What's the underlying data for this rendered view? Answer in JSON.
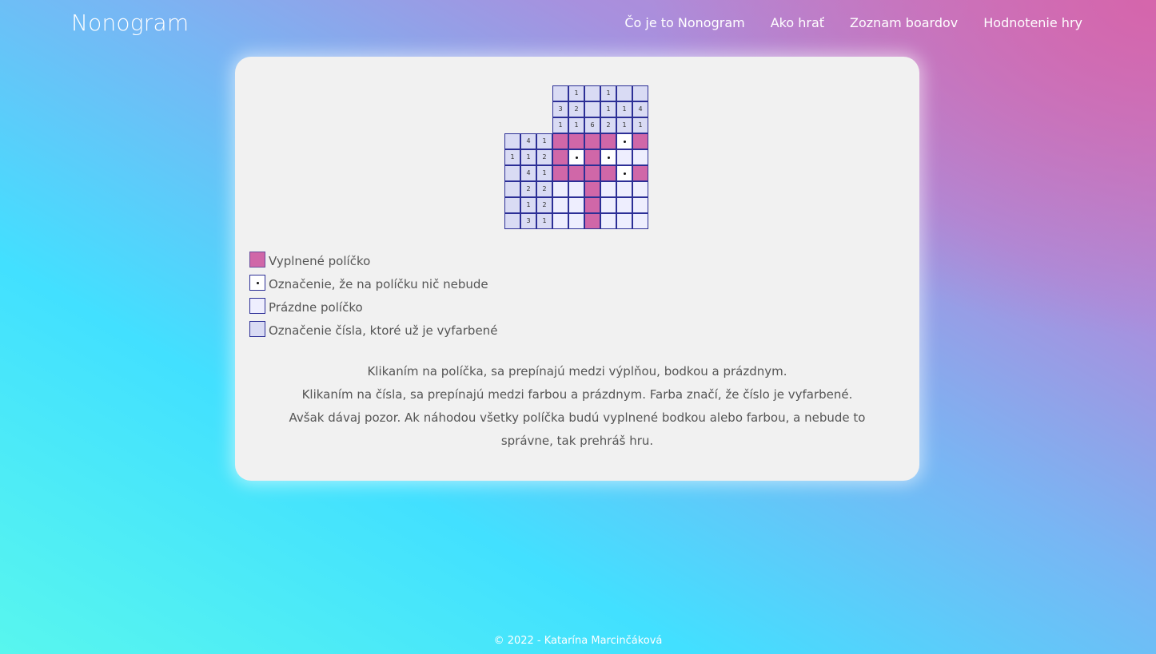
{
  "header": {
    "brand": "Nonogram",
    "nav": [
      "Čo je to Nonogram",
      "Ako hrať",
      "Zoznam boardov",
      "Hodnotenie hry"
    ]
  },
  "board": {
    "column_clues": [
      [
        "",
        "3",
        "1"
      ],
      [
        "1",
        "2",
        "1"
      ],
      [
        "",
        "",
        "6"
      ],
      [
        "1",
        "1",
        "2"
      ],
      [
        "",
        "1",
        "1"
      ],
      [
        "",
        "4",
        "1"
      ]
    ],
    "row_clues": [
      [
        "",
        "4",
        "1"
      ],
      [
        "1",
        "1",
        "2"
      ],
      [
        "",
        "4",
        "1"
      ],
      [
        "",
        "2",
        "2"
      ],
      [
        "",
        "1",
        "2"
      ],
      [
        "",
        "3",
        "1"
      ]
    ],
    "grid": [
      [
        "f",
        "f",
        "f",
        "f",
        "d",
        "f"
      ],
      [
        "f",
        "d",
        "f",
        "d",
        "e",
        "e"
      ],
      [
        "f",
        "f",
        "f",
        "f",
        "d",
        "f"
      ],
      [
        "e",
        "e",
        "f",
        "e",
        "e",
        "e"
      ],
      [
        "e",
        "e",
        "f",
        "e",
        "e",
        "e"
      ],
      [
        "e",
        "e",
        "f",
        "e",
        "e",
        "e"
      ]
    ]
  },
  "legend": [
    {
      "type": "filled",
      "label": "Vyplnené políčko"
    },
    {
      "type": "dotted",
      "label": "Označenie, že na políčku nič nebude"
    },
    {
      "type": "empty",
      "label": "Prázdne políčko"
    },
    {
      "type": "clue",
      "label": "Označenie čísla, ktoré už je vyfarbené"
    }
  ],
  "description": [
    "Klikaním na políčka, sa prepínajú medzi výplňou, bodkou a prázdnym.",
    "Klikaním na čísla, sa prepínajú medzi farbou a prázdnym. Farba značí, že číslo je vyfarbené.",
    "Avšak dávaj pozor. Ak náhodou všetky políčka budú vyplnené bodkou alebo farbou, a nebude to správne, tak prehráš hru."
  ],
  "footer": "© 2022 - Katarína Marcinčáková",
  "colors": {
    "filled": "#d067a8",
    "clue": "#d9dbf4",
    "empty": "#eeeefe",
    "border": "#2c2f96"
  }
}
